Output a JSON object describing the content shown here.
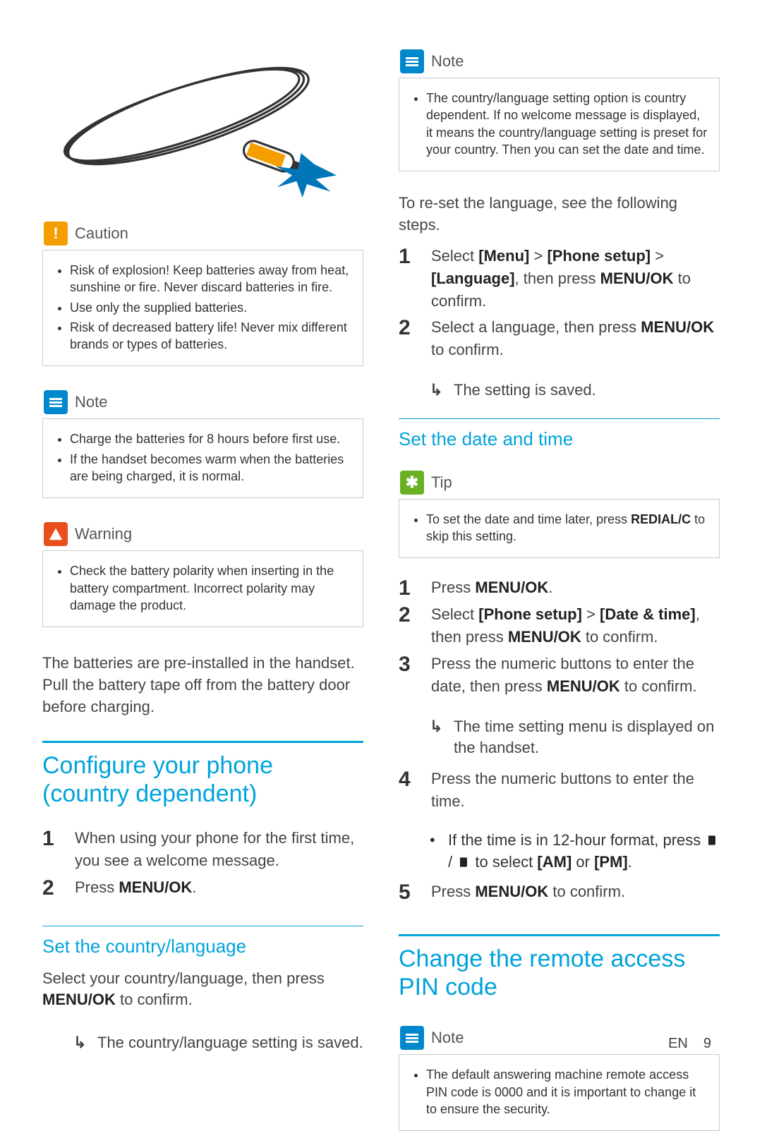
{
  "footer": {
    "lang": "EN",
    "page": "9"
  },
  "left": {
    "caution": {
      "title": "Caution",
      "items": [
        "Risk of explosion! Keep batteries away from heat, sunshine or fire. Never discard batteries in fire.",
        "Use only the supplied batteries.",
        "Risk of decreased battery life! Never mix different brands or types of batteries."
      ]
    },
    "note": {
      "title": "Note",
      "items": [
        "Charge the batteries for 8 hours before first use.",
        "If the handset becomes warm when the batteries are being charged, it is normal."
      ]
    },
    "warning": {
      "title": "Warning",
      "items": [
        "Check the battery polarity when inserting in the battery compartment. Incorrect polarity may damage the product."
      ]
    },
    "pre_installed": "The batteries are pre-installed in the handset. Pull the battery tape off from the battery door before charging.",
    "h1_configure": "Configure your phone (country dependent)",
    "steps_configure": {
      "s1": "When using your phone for the first time, you see a welcome message.",
      "s2_pre": "Press ",
      "s2_bold": "MENU/OK",
      "s2_post": "."
    },
    "h2_country": "Set the country/language",
    "country_intro_pre": "Select your country/language, then press ",
    "country_intro_bold": "MENU/OK",
    "country_intro_post": " to confirm.",
    "country_result": "The country/language setting is saved."
  },
  "right": {
    "note_country": {
      "title": "Note",
      "items": [
        "The country/language setting option is country dependent. If no welcome message is displayed, it means the country/language setting is preset for your country. Then you can set the date and time."
      ]
    },
    "reset_intro": "To re-set the language, see the following steps.",
    "reset": {
      "s1": {
        "pre": "Select ",
        "b1": "[Menu]",
        "gt1": " > ",
        "b2": "[Phone setup]",
        "gt2": " > ",
        "b3": "[Language]",
        "mid": ", then press ",
        "b4": "MENU/OK",
        "post": " to confirm."
      },
      "s2": {
        "pre": "Select a language, then press ",
        "b1": "MENU/OK",
        "post": " to confirm."
      },
      "s2_result": "The setting is saved."
    },
    "h2_datetime": "Set the date and time",
    "tip": {
      "title": "Tip",
      "item_pre": "To set the date and time later, press ",
      "item_bold": "REDIAL/C",
      "item_post": " to skip this setting."
    },
    "dt": {
      "s1": {
        "pre": "Press ",
        "b1": "MENU/OK",
        "post": "."
      },
      "s2": {
        "pre": "Select ",
        "b1": "[Phone setup]",
        "gt": " > ",
        "b2": "[Date & time]",
        "mid": ", then press ",
        "b3": "MENU/OK",
        "post": " to confirm."
      },
      "s3": {
        "pre": "Press the numeric buttons to enter the date, then press ",
        "b1": "MENU/OK",
        "post": " to confirm."
      },
      "s3_result": "The time setting menu is displayed on the handset.",
      "s4": "Press the numeric buttons to enter the time.",
      "s4_sub_pre": "If the time is in 12-hour format, press ",
      "s4_sub_mid": " / ",
      "s4_sub_post_pre": " to select ",
      "s4_sub_b1": "[AM]",
      "s4_sub_or": " or ",
      "s4_sub_b2": "[PM]",
      "s4_sub_end": ".",
      "s5": {
        "pre": "Press ",
        "b1": "MENU/OK",
        "post": " to confirm."
      }
    },
    "h1_pin": "Change the remote access PIN code",
    "note_pin": {
      "title": "Note",
      "items": [
        "The default answering machine remote access PIN code is 0000 and it is important to change it to ensure the security."
      ]
    }
  }
}
